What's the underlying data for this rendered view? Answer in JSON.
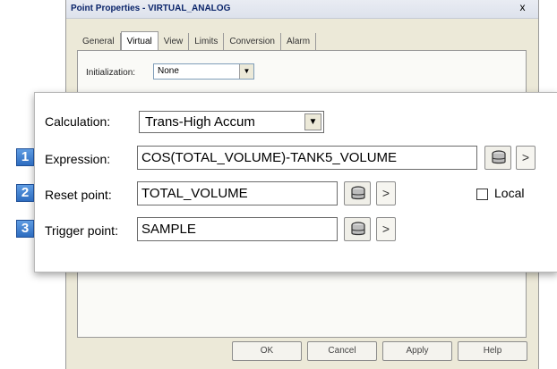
{
  "window": {
    "title": "Point Properties - VIRTUAL_ANALOG",
    "close_glyph": "x"
  },
  "tabs": [
    {
      "label": "General"
    },
    {
      "label": "Virtual",
      "active": true
    },
    {
      "label": "View"
    },
    {
      "label": "Limits"
    },
    {
      "label": "Conversion"
    },
    {
      "label": "Alarm"
    }
  ],
  "initialization": {
    "label": "Initialization:",
    "value": "None"
  },
  "calculation": {
    "label": "Calculation:",
    "value": "Trans-High Accum"
  },
  "expression": {
    "badge": "1",
    "label": "Expression:",
    "value": "COS(TOTAL_VOLUME)-TANK5_VOLUME"
  },
  "reset_point": {
    "badge": "2",
    "label": "Reset point:",
    "value": "TOTAL_VOLUME"
  },
  "trigger_point": {
    "badge": "3",
    "label": "Trigger point:",
    "value": "SAMPLE"
  },
  "local": {
    "label": "Local",
    "checked": false
  },
  "buttons": {
    "ok": "OK",
    "cancel": "Cancel",
    "apply": "Apply",
    "help": "Help",
    "arrow": ">"
  },
  "icons": {
    "browse": "database-browse-icon",
    "dropdown": "chevron-down-icon"
  },
  "colors": {
    "badge": "#2d6cc0",
    "title_text": "#0a246a",
    "dialog_bg": "#ece9d8"
  }
}
